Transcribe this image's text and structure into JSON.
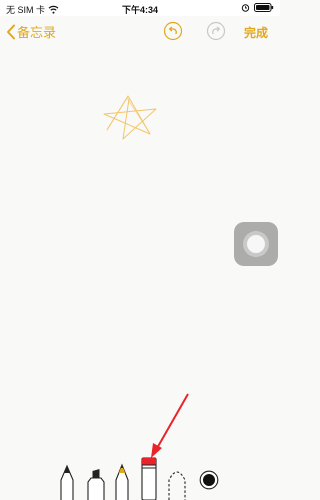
{
  "status_bar": {
    "carrier": "无 SIM 卡",
    "time": "下午4:34"
  },
  "nav": {
    "back_label": "备忘录",
    "done_label": "完成"
  },
  "colors": {
    "accent": "#e3a81a",
    "sketch": "#f2c66a",
    "annotation_arrow": "#e8242a",
    "selected_tool": "#e8242a"
  },
  "icons": {
    "back": "chevron-left-icon",
    "undo": "undo-icon",
    "redo": "redo-icon",
    "assistive_touch": "assistive-touch-icon"
  },
  "toolbar": {
    "tools": [
      "pen",
      "marker",
      "pencil",
      "eraser",
      "lasso",
      "color-picker"
    ],
    "selected_tool": "eraser"
  }
}
